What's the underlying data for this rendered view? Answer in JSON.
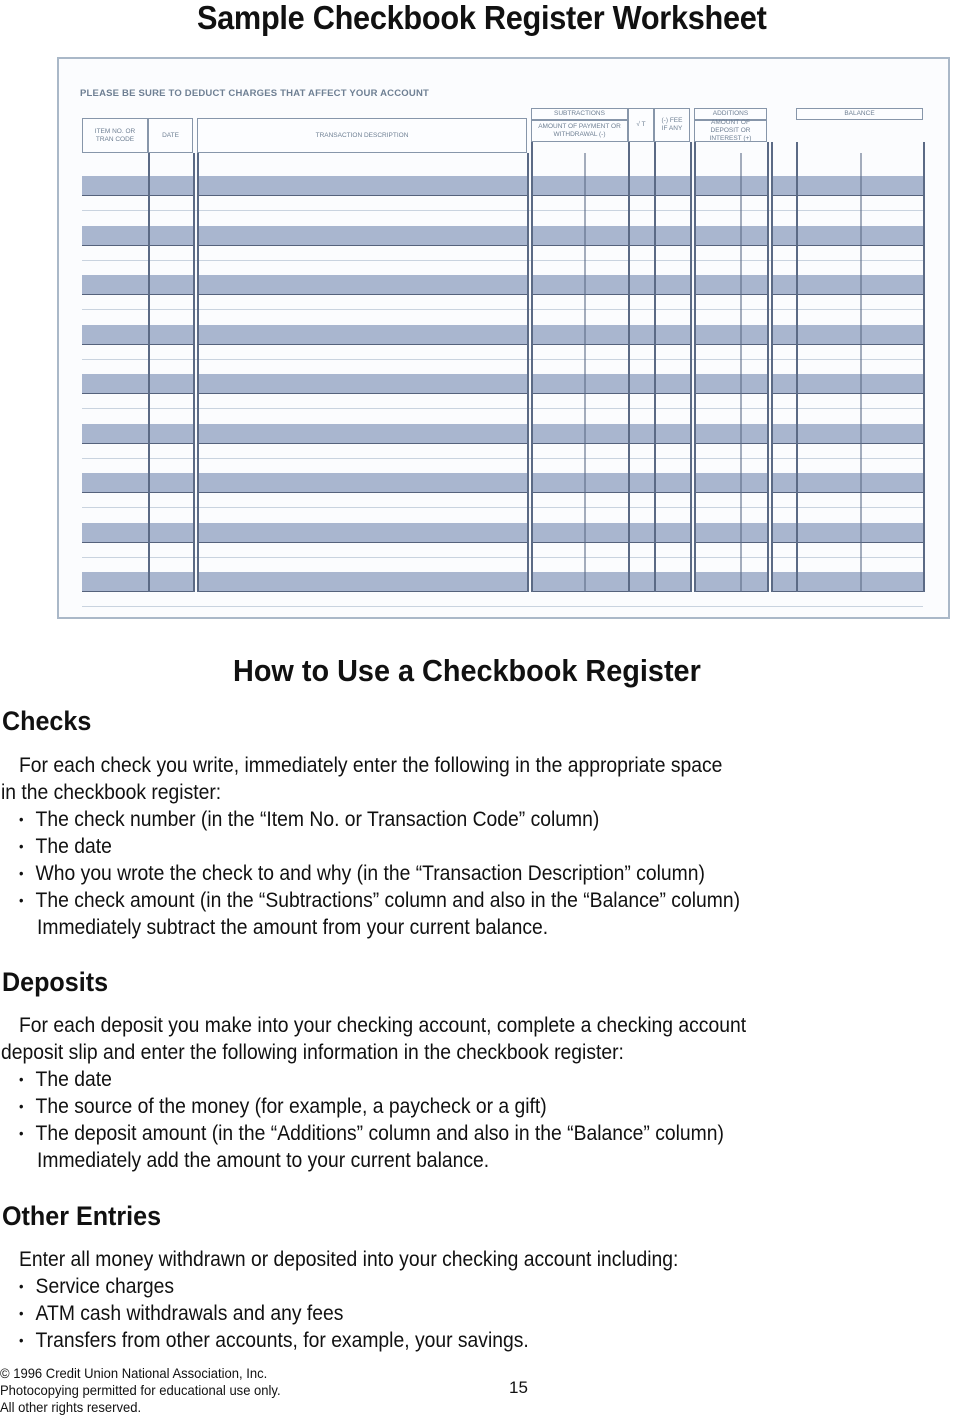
{
  "page_title": "Sample Checkbook Register Worksheet",
  "register": {
    "notice": "PLEASE BE SURE TO DEDUCT CHARGES THAT AFFECT YOUR ACCOUNT",
    "columns": {
      "item_no": "ITEM NO. OR TRAN CODE",
      "date": "DATE",
      "description": "TRANSACTION DESCRIPTION",
      "subtractions_group": "SUBTRACTIONS",
      "subtractions": "AMOUNT OF PAYMENT OR WITHDRAWAL (-)",
      "check": "√ T",
      "fee": "(-) FEE IF ANY",
      "additions_group": "ADDITIONS",
      "additions": "AMOUNT OF DEPOSIT OR INTEREST (+)",
      "balance": "BALANCE"
    },
    "shaded_rows": 9,
    "stripe_color": "#a9b6cf",
    "line_color": "#5b6a85"
  },
  "howto": {
    "title": "How to Use a Checkbook Register",
    "sections": [
      {
        "heading": "Checks",
        "intro": [
          "For each check you write, immediately enter the following in the appropriate space",
          "in the checkbook register:"
        ],
        "bullets": [
          "The check number (in the “Item No. or Transaction Code” column)",
          "The date",
          "Who you wrote the check to and why (in the “Transaction Description” column)",
          "The check amount (in the “Subtractions” column and also in the “Balance” column)"
        ],
        "note": "Immediately subtract the amount from your current balance."
      },
      {
        "heading": "Deposits",
        "intro": [
          "For each deposit you make into your checking account, complete a checking account",
          "deposit slip and enter the following information in the checkbook register:"
        ],
        "bullets": [
          "The date",
          "The source of the money (for example, a paycheck or a gift)",
          "The deposit amount (in the “Additions” column and also in the “Balance” column)"
        ],
        "note": "Immediately add the amount to your current balance."
      },
      {
        "heading": "Other Entries",
        "intro": [
          "Enter all money withdrawn or deposited into your checking account including:"
        ],
        "bullets": [
          "Service charges",
          "ATM cash withdrawals and any fees",
          "Transfers from other accounts, for example, your savings."
        ]
      }
    ]
  },
  "footer": {
    "copyright": "© 1996 Credit Union National Association, Inc.",
    "permission": "Photocopying permitted for educational use only.",
    "rights": "All other rights reserved.",
    "page_number": "15"
  }
}
